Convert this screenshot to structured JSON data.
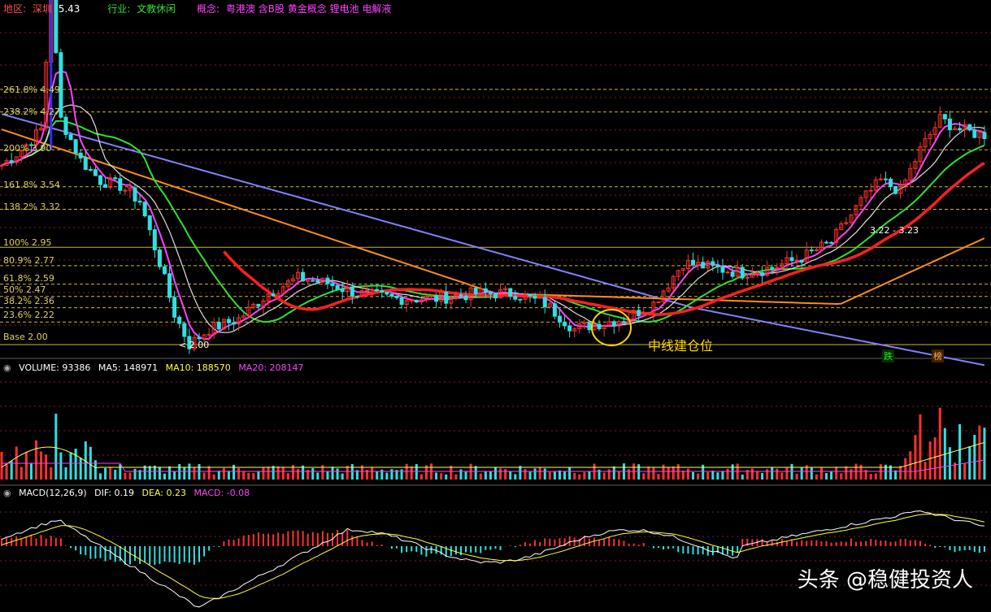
{
  "header": {
    "region_label": "地区:",
    "region_value": "深圳",
    "price_peak": "5.43",
    "industry_label": "行业:",
    "industry_value": "文教休闲",
    "concept_label": "概念:",
    "concept_value": "粤港澳 含B股 黄金概念 锂电池 电解液"
  },
  "colors": {
    "background": "#000000",
    "grid": "#7a2020",
    "fib_line": "#c8b830",
    "ma_slow": "#8080ff",
    "ma_mid": "#ff8c1a",
    "ma_green": "#30e030",
    "ma_magenta": "#ff40ff",
    "ma_white": "#e0e0e0",
    "ma_red_thick": "#ff2020",
    "up_candle": "#ff3030",
    "down_candle": "#30e0e0"
  },
  "fib_levels": [
    {
      "label": "261.8% 4.49",
      "price": 4.49
    },
    {
      "label": "238.2% 4.27",
      "price": 4.27
    },
    {
      "label": "200% 3.90",
      "price": 3.9
    },
    {
      "label": "161.8% 3.54",
      "price": 3.54
    },
    {
      "label": "138.2% 3.32",
      "price": 3.32
    },
    {
      "label": "100% 2.95",
      "price": 2.95
    },
    {
      "label": "80.9% 2.77",
      "price": 2.77
    },
    {
      "label": "61.8% 2.59",
      "price": 2.59
    },
    {
      "label": "50% 2.47",
      "price": 2.47
    },
    {
      "label": "38.2% 2.36",
      "price": 2.36
    },
    {
      "label": "23.6% 2.22",
      "price": 2.22
    },
    {
      "label": "Base 2.00",
      "price": 2.0
    }
  ],
  "annotations": {
    "low_marker": "< 2.00",
    "range_label": "3.22 - 3.23",
    "position_note": "中线建仓位",
    "badge_1": "跌",
    "badge_2": "榜"
  },
  "volume_panel": {
    "title": "VOLUME: 93386",
    "ma5": "MA5: 148971",
    "ma10": "MA10: 188570",
    "ma20": "MA20: 208147"
  },
  "macd_panel": {
    "title": "MACD(12,26,9)",
    "dif": "DIF: 0.19",
    "dea": "DEA: 0.23",
    "macd": "MACD: -0.08"
  },
  "watermark": "头条 @稳健投资人",
  "chart_data": [
    {
      "type": "line",
      "name": "K-line price",
      "ylim": [
        1.9,
        5.5
      ],
      "price_path": [
        [
          0,
          3.75
        ],
        [
          4,
          3.9
        ],
        [
          8,
          4.1
        ],
        [
          10,
          5.43
        ],
        [
          12,
          4.2
        ],
        [
          16,
          3.8
        ],
        [
          20,
          3.6
        ],
        [
          24,
          3.55
        ],
        [
          28,
          3.4
        ],
        [
          32,
          2.8
        ],
        [
          35,
          2.3
        ],
        [
          38,
          2.0
        ],
        [
          42,
          2.15
        ],
        [
          48,
          2.25
        ],
        [
          54,
          2.5
        ],
        [
          60,
          2.65
        ],
        [
          66,
          2.6
        ],
        [
          72,
          2.5
        ],
        [
          80,
          2.45
        ],
        [
          88,
          2.45
        ],
        [
          96,
          2.5
        ],
        [
          104,
          2.5
        ],
        [
          110,
          2.4
        ],
        [
          116,
          2.15
        ],
        [
          120,
          2.2
        ],
        [
          126,
          2.25
        ],
        [
          132,
          2.4
        ],
        [
          138,
          2.8
        ],
        [
          144,
          2.75
        ],
        [
          150,
          2.7
        ],
        [
          156,
          2.75
        ],
        [
          162,
          2.85
        ],
        [
          168,
          3.0
        ],
        [
          174,
          3.4
        ],
        [
          178,
          3.6
        ],
        [
          182,
          3.5
        ],
        [
          186,
          3.9
        ],
        [
          190,
          4.2
        ],
        [
          194,
          4.1
        ],
        [
          198,
          4.05
        ]
      ]
    },
    {
      "type": "bar",
      "name": "Volume",
      "pattern": "low steady volume with spikes near the start and surge at the right end"
    },
    {
      "type": "bar",
      "name": "MACD histogram",
      "pattern": "positive early, deep negative dip, oscillations, strong positive near right then turning negative"
    }
  ]
}
